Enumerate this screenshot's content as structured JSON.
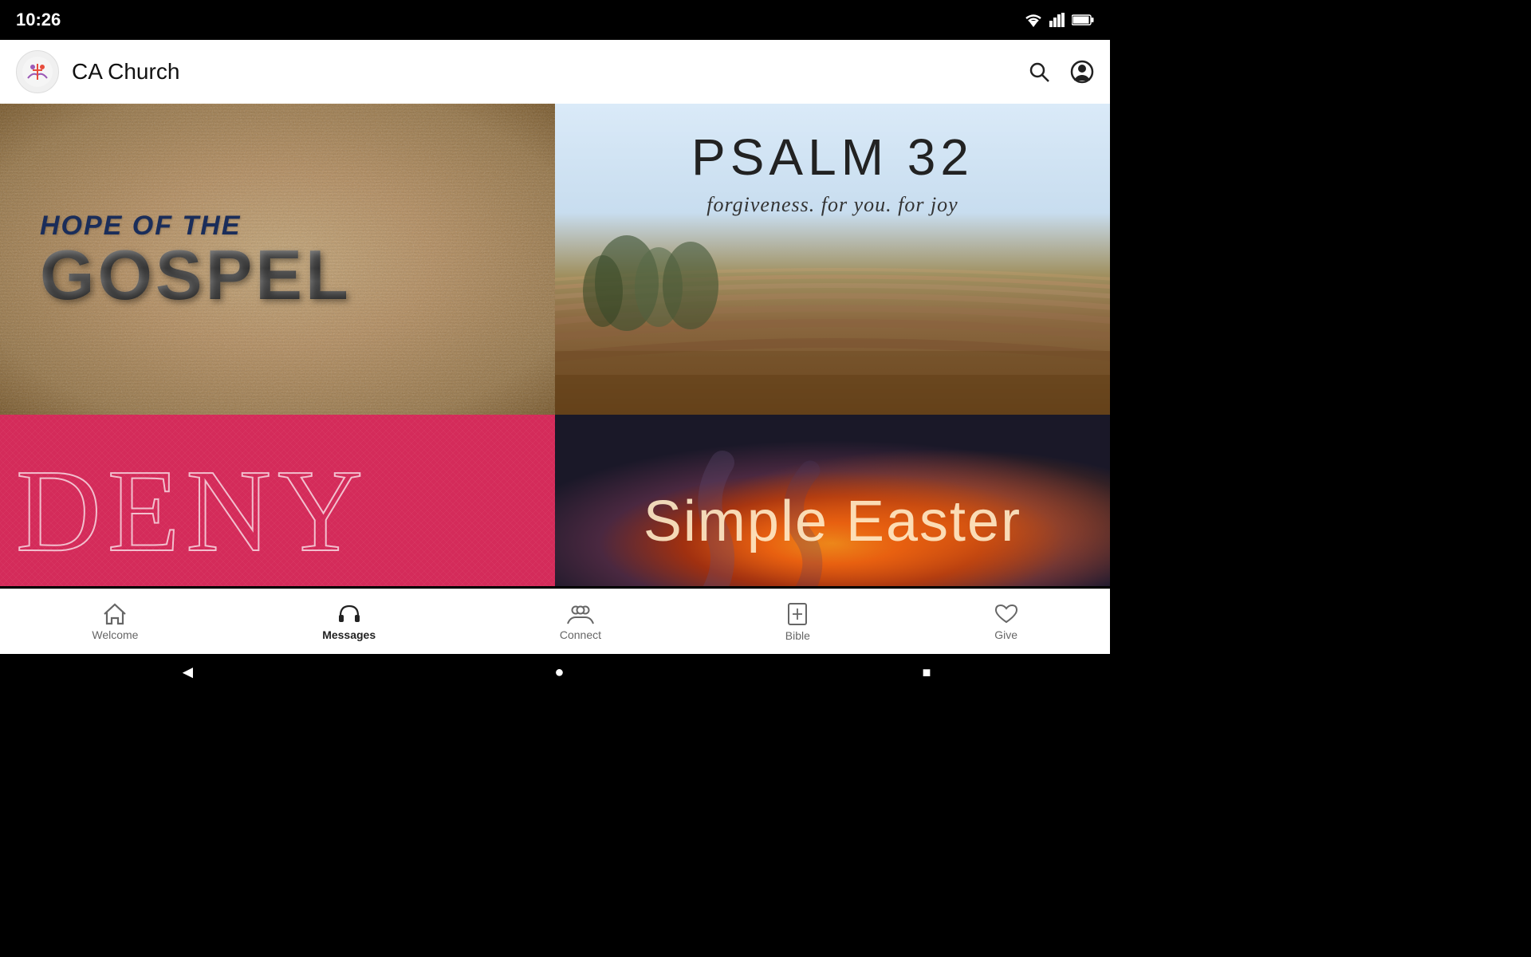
{
  "statusBar": {
    "time": "10:26",
    "wifiIcon": "▼",
    "signalIcon": "▲▲",
    "batteryIcon": "🔋"
  },
  "appBar": {
    "title": "CA Church",
    "searchLabel": "search",
    "profileLabel": "profile"
  },
  "cards": [
    {
      "id": "gospel",
      "line1": "HOPE OF THE",
      "line2": "GOSPEL"
    },
    {
      "id": "psalm",
      "title": "PSALM 32",
      "subtitle": "forgiveness. for you. for joy"
    },
    {
      "id": "deny",
      "text": "DENY"
    },
    {
      "id": "easter",
      "text": "Simple Easter"
    }
  ],
  "bottomNav": {
    "items": [
      {
        "id": "welcome",
        "label": "Welcome",
        "icon": "home",
        "active": false
      },
      {
        "id": "messages",
        "label": "Messages",
        "icon": "headphones",
        "active": true
      },
      {
        "id": "connect",
        "label": "Connect",
        "icon": "people",
        "active": false
      },
      {
        "id": "bible",
        "label": "Bible",
        "icon": "book",
        "active": false
      },
      {
        "id": "give",
        "label": "Give",
        "icon": "heart",
        "active": false
      }
    ]
  },
  "systemNav": {
    "backLabel": "◄",
    "homeLabel": "●",
    "recentLabel": "■"
  }
}
